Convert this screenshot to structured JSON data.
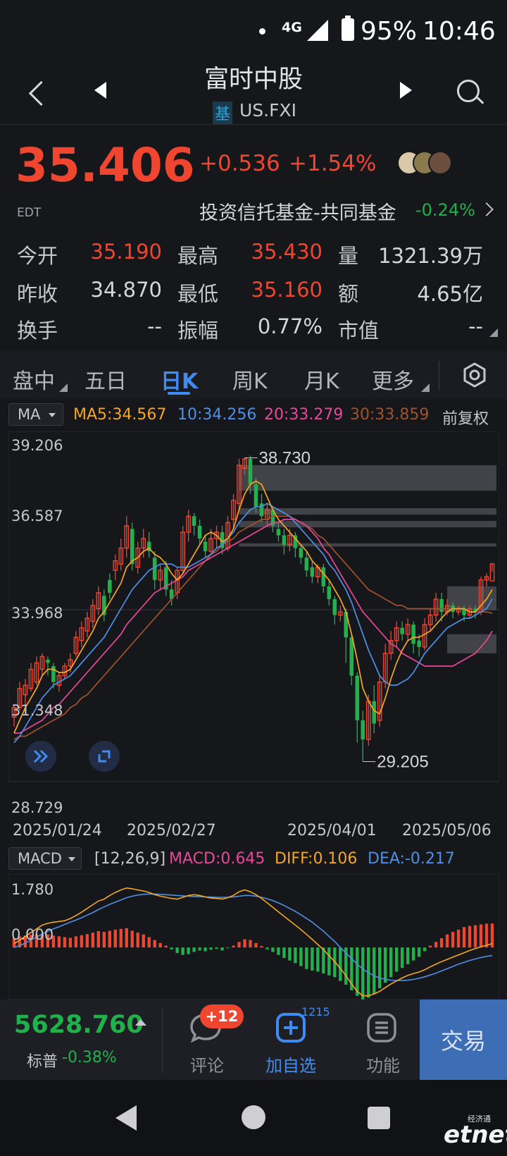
{
  "status_bar": {
    "network": "4G",
    "battery": "95%",
    "time": "10:46"
  },
  "header": {
    "title": "富时中股",
    "badge": "基",
    "ticker": "US.FXI"
  },
  "quote": {
    "price": "35.406",
    "timezone": "EDT",
    "change": "+0.536",
    "change_pct": "+1.54%",
    "category": "投资信托基金-共同基金",
    "category_change": "-0.24%"
  },
  "stats": [
    {
      "label": "今开",
      "value": "35.190",
      "color": "red"
    },
    {
      "label": "最高",
      "value": "35.430",
      "color": "red"
    },
    {
      "label": "量",
      "value": "1321.39万",
      "color": "plain"
    },
    {
      "label": "昨收",
      "value": "34.870",
      "color": "plain"
    },
    {
      "label": "最低",
      "value": "35.160",
      "color": "red"
    },
    {
      "label": "额",
      "value": "4.65亿",
      "color": "plain"
    },
    {
      "label": "换手",
      "value": "--",
      "color": "plain"
    },
    {
      "label": "振幅",
      "value": "0.77%",
      "color": "plain"
    },
    {
      "label": "市值",
      "value": "--",
      "color": "plain"
    }
  ],
  "tabs": [
    "盘中",
    "五日",
    "日K",
    "周K",
    "月K",
    "更多"
  ],
  "active_tab": "日K",
  "ma_legend": {
    "selector": "MA",
    "ma5": "MA5:34.567",
    "ma10": "10:34.256",
    "ma20": "20:33.279",
    "ma30": "30:33.859",
    "adjust": "前复权"
  },
  "colors": {
    "up": "#f0452e",
    "down": "#1fb24a",
    "ma5": "#f5a623",
    "ma10": "#4f8fe6",
    "ma20": "#e8479a",
    "ma30": "#a0522d",
    "accent": "#3e8cf1",
    "trade": "#3d6db4"
  },
  "chart_data": {
    "type": "candlestick",
    "y_axis_labels": [
      "39.206",
      "36.587",
      "33.968",
      "31.348",
      "28.729"
    ],
    "ylim": [
      28.729,
      39.206
    ],
    "x_axis_labels": [
      "2025/01/24",
      "2025/02/27",
      "2025/04/01",
      "2025/05/06"
    ],
    "high_annotation": "38.730",
    "low_annotation": "29.205",
    "candles": [
      [
        30.6,
        30.9,
        30.3,
        31.0
      ],
      [
        30.9,
        31.5,
        30.8,
        31.7
      ],
      [
        31.3,
        31.6,
        31.0,
        31.8
      ],
      [
        31.5,
        32.1,
        31.4,
        32.3
      ],
      [
        31.7,
        32.3,
        31.6,
        32.5
      ],
      [
        32.1,
        32.5,
        31.9,
        32.6
      ],
      [
        32.4,
        32.3,
        31.9,
        32.5
      ],
      [
        32.2,
        31.7,
        31.5,
        32.3
      ],
      [
        31.6,
        31.9,
        31.4,
        32.0
      ],
      [
        31.9,
        32.2,
        31.8,
        32.3
      ],
      [
        32.2,
        32.4,
        32.0,
        32.6
      ],
      [
        32.6,
        33.1,
        32.5,
        33.3
      ],
      [
        33.0,
        33.4,
        32.8,
        33.6
      ],
      [
        33.3,
        33.7,
        33.1,
        33.9
      ],
      [
        33.6,
        34.1,
        33.4,
        34.3
      ],
      [
        34.0,
        34.5,
        33.8,
        34.7
      ],
      [
        34.4,
        33.8,
        33.6,
        34.6
      ],
      [
        34.9,
        34.5,
        34.3,
        35.1
      ],
      [
        35.2,
        35.5,
        34.9,
        35.7
      ],
      [
        35.4,
        35.9,
        35.2,
        36.2
      ],
      [
        35.9,
        36.6,
        35.6,
        36.9
      ],
      [
        36.5,
        35.4,
        35.2,
        36.7
      ],
      [
        35.3,
        35.9,
        35.1,
        36.1
      ],
      [
        35.9,
        36.2,
        35.6,
        36.5
      ],
      [
        36.1,
        35.8,
        35.6,
        36.4
      ],
      [
        35.6,
        34.9,
        34.6,
        35.8
      ],
      [
        34.9,
        35.2,
        34.6,
        35.4
      ],
      [
        35.3,
        34.6,
        34.4,
        35.5
      ],
      [
        34.6,
        34.3,
        34.1,
        34.9
      ],
      [
        34.5,
        35.2,
        34.3,
        35.3
      ],
      [
        35.2,
        36.4,
        35.1,
        36.6
      ],
      [
        36.4,
        36.9,
        36.1,
        37.1
      ],
      [
        36.9,
        36.6,
        36.3,
        37.0
      ],
      [
        36.6,
        36.2,
        36.0,
        36.8
      ],
      [
        36.1,
        35.8,
        35.6,
        36.3
      ],
      [
        35.8,
        36.2,
        35.7,
        36.5
      ],
      [
        36.2,
        36.4,
        35.9,
        36.6
      ],
      [
        36.4,
        35.9,
        35.7,
        36.6
      ],
      [
        35.9,
        36.7,
        35.8,
        36.9
      ],
      [
        36.8,
        37.4,
        36.5,
        37.6
      ],
      [
        37.3,
        38.5,
        37.1,
        38.7
      ],
      [
        38.4,
        38.7,
        38.2,
        38.73
      ],
      [
        38.7,
        37.9,
        37.6,
        38.8
      ],
      [
        37.9,
        37.2,
        37.0,
        38.1
      ],
      [
        37.3,
        36.9,
        36.7,
        37.6
      ],
      [
        36.8,
        37.1,
        36.6,
        37.3
      ],
      [
        37.1,
        36.6,
        36.4,
        37.2
      ],
      [
        36.5,
        36.3,
        36.1,
        36.7
      ],
      [
        36.3,
        36.0,
        35.7,
        36.5
      ],
      [
        36.0,
        36.3,
        35.8,
        36.5
      ],
      [
        36.3,
        35.9,
        35.6,
        36.4
      ],
      [
        35.9,
        35.6,
        35.4,
        36.0
      ],
      [
        35.6,
        35.2,
        35.0,
        35.8
      ],
      [
        35.3,
        35.0,
        34.8,
        35.5
      ],
      [
        35.0,
        35.3,
        34.8,
        35.4
      ],
      [
        35.3,
        34.7,
        34.5,
        35.4
      ],
      [
        34.7,
        34.3,
        34.1,
        34.9
      ],
      [
        34.3,
        33.8,
        33.5,
        34.4
      ],
      [
        33.8,
        33.9,
        33.6,
        34.1
      ],
      [
        33.9,
        33.1,
        32.3,
        34.0
      ],
      [
        33.1,
        31.9,
        31.6,
        33.2
      ],
      [
        31.9,
        30.5,
        29.8,
        32.0
      ],
      [
        30.5,
        29.9,
        29.205,
        30.8
      ],
      [
        29.9,
        31.1,
        29.7,
        31.3
      ],
      [
        31.1,
        30.4,
        30.1,
        31.6
      ],
      [
        30.5,
        31.7,
        30.3,
        31.9
      ],
      [
        31.7,
        32.6,
        31.5,
        32.9
      ],
      [
        32.6,
        33.0,
        32.4,
        33.3
      ],
      [
        33.0,
        33.4,
        32.8,
        33.6
      ],
      [
        33.4,
        33.2,
        33.0,
        33.6
      ],
      [
        33.2,
        33.5,
        33.0,
        33.7
      ],
      [
        33.5,
        32.9,
        32.6,
        33.6
      ],
      [
        33.0,
        32.8,
        32.5,
        33.2
      ],
      [
        32.8,
        33.5,
        32.7,
        33.7
      ],
      [
        33.5,
        33.8,
        33.3,
        34.0
      ],
      [
        33.8,
        34.3,
        33.6,
        34.5
      ],
      [
        34.3,
        33.9,
        33.6,
        34.5
      ],
      [
        33.9,
        34.1,
        33.8,
        34.3
      ],
      [
        34.1,
        33.9,
        33.7,
        34.2
      ],
      [
        33.9,
        34.0,
        33.8,
        34.1
      ],
      [
        34.0,
        33.8,
        33.6,
        34.1
      ],
      [
        33.8,
        34.0,
        33.7,
        34.1
      ],
      [
        34.0,
        33.9,
        33.7,
        34.1
      ],
      [
        33.9,
        34.9,
        33.8,
        35.0
      ],
      [
        34.9,
        35.0,
        34.7,
        35.1
      ],
      [
        34.87,
        35.406,
        35.16,
        35.43
      ]
    ],
    "ma5": [
      30.1,
      30.5,
      30.9,
      31.2,
      31.5,
      31.9,
      32.1,
      32.1,
      32.0,
      32.0,
      32.1,
      32.4,
      32.7,
      33.0,
      33.3,
      33.7,
      33.9,
      34.2,
      34.5,
      34.8,
      35.3,
      35.5,
      35.6,
      35.8,
      35.9,
      35.7,
      35.6,
      35.4,
      35.1,
      34.9,
      35.1,
      35.4,
      35.7,
      36.0,
      36.3,
      36.4,
      36.3,
      36.1,
      36.2,
      36.5,
      37.1,
      37.6,
      37.9,
      38.0,
      37.9,
      37.5,
      37.1,
      36.8,
      36.6,
      36.4,
      36.2,
      36.0,
      35.8,
      35.5,
      35.3,
      35.1,
      34.9,
      34.6,
      34.3,
      33.9,
      33.2,
      32.4,
      31.5,
      31.1,
      30.8,
      30.7,
      31.2,
      31.8,
      32.3,
      32.7,
      33.0,
      33.1,
      33.1,
      33.2,
      33.3,
      33.5,
      33.7,
      33.9,
      34.0,
      34.0,
      34.0,
      33.9,
      33.9,
      34.1,
      34.3,
      34.6
    ],
    "ma10": [
      29.8,
      30.0,
      30.3,
      30.6,
      30.9,
      31.2,
      31.4,
      31.6,
      31.7,
      31.8,
      31.9,
      32.1,
      32.3,
      32.5,
      32.7,
      32.9,
      33.1,
      33.4,
      33.7,
      34.0,
      34.3,
      34.6,
      34.8,
      35.0,
      35.2,
      35.3,
      35.4,
      35.4,
      35.4,
      35.3,
      35.3,
      35.3,
      35.4,
      35.5,
      35.6,
      35.7,
      35.9,
      36.0,
      36.2,
      36.4,
      36.7,
      36.9,
      37.1,
      37.2,
      37.2,
      37.3,
      37.2,
      37.1,
      37.0,
      36.9,
      36.7,
      36.5,
      36.3,
      36.1,
      35.9,
      35.7,
      35.4,
      35.2,
      34.9,
      34.6,
      34.2,
      33.7,
      33.2,
      32.7,
      32.3,
      31.9,
      31.7,
      31.6,
      31.6,
      31.7,
      31.8,
      32.0,
      32.3,
      32.6,
      32.8,
      33.0,
      33.2,
      33.4,
      33.5,
      33.6,
      33.7,
      33.7,
      33.8,
      33.9,
      34.0,
      34.3
    ],
    "ma20": [
      30.1,
      30.1,
      30.2,
      30.3,
      30.4,
      30.5,
      30.7,
      30.9,
      31.0,
      31.2,
      31.4,
      31.6,
      31.8,
      32.0,
      32.2,
      32.4,
      32.6,
      32.8,
      33.0,
      33.2,
      33.5,
      33.7,
      33.9,
      34.1,
      34.3,
      34.5,
      34.6,
      34.7,
      34.8,
      34.9,
      35.0,
      35.2,
      35.3,
      35.4,
      35.5,
      35.6,
      35.7,
      35.8,
      35.9,
      36.0,
      36.1,
      36.2,
      36.3,
      36.4,
      36.5,
      36.6,
      36.7,
      36.7,
      36.8,
      36.8,
      36.8,
      36.7,
      36.6,
      36.4,
      36.2,
      35.9,
      35.7,
      35.4,
      35.1,
      34.8,
      34.5,
      34.2,
      33.9,
      33.7,
      33.5,
      33.3,
      33.1,
      32.9,
      32.8,
      32.6,
      32.5,
      32.4,
      32.3,
      32.2,
      32.2,
      32.2,
      32.2,
      32.2,
      32.2,
      32.3,
      32.4,
      32.5,
      32.6,
      32.8,
      33.0,
      33.3
    ],
    "ma30": [
      29.9,
      30.0,
      30.0,
      30.1,
      30.2,
      30.3,
      30.4,
      30.5,
      30.6,
      30.7,
      30.9,
      31.0,
      31.2,
      31.3,
      31.5,
      31.7,
      31.9,
      32.1,
      32.3,
      32.5,
      32.7,
      32.9,
      33.1,
      33.3,
      33.5,
      33.7,
      33.9,
      34.1,
      34.3,
      34.5,
      34.7,
      34.9,
      35.1,
      35.3,
      35.5,
      35.7,
      35.8,
      36.0,
      36.1,
      36.2,
      36.4,
      36.5,
      36.6,
      36.7,
      36.8,
      36.8,
      36.9,
      36.9,
      36.9,
      36.9,
      36.8,
      36.7,
      36.6,
      36.5,
      36.3,
      36.2,
      36.0,
      35.8,
      35.6,
      35.4,
      35.2,
      35.0,
      34.8,
      34.6,
      34.5,
      34.4,
      34.3,
      34.2,
      34.1,
      34.1,
      34.0,
      34.0,
      34.0,
      34.0,
      34.0,
      34.0,
      34.0,
      34.0,
      34.0,
      34.0,
      34.0,
      33.9,
      33.9,
      33.9,
      33.9,
      33.86
    ]
  },
  "macd": {
    "selector": "MACD",
    "params": "[12,26,9]",
    "macd": "MACD:0.645",
    "diff": "DIFF:0.106",
    "dea": "DEA:-0.217",
    "y_axis_labels": [
      "1.780",
      "0.000"
    ]
  },
  "macd_data": {
    "ylim": [
      -1.4,
      1.9
    ],
    "hist": [
      0.25,
      0.3,
      0.32,
      0.34,
      0.35,
      0.36,
      0.35,
      0.32,
      0.3,
      0.28,
      0.26,
      0.3,
      0.33,
      0.36,
      0.4,
      0.44,
      0.42,
      0.45,
      0.48,
      0.5,
      0.52,
      0.45,
      0.4,
      0.35,
      0.28,
      0.2,
      0.12,
      0.05,
      -0.05,
      -0.15,
      -0.2,
      -0.18,
      -0.12,
      -0.08,
      -0.1,
      -0.06,
      -0.04,
      -0.08,
      -0.02,
      0.05,
      0.15,
      0.22,
      0.2,
      0.12,
      0.04,
      -0.05,
      -0.12,
      -0.2,
      -0.28,
      -0.35,
      -0.42,
      -0.5,
      -0.58,
      -0.62,
      -0.65,
      -0.7,
      -0.75,
      -0.8,
      -0.9,
      -1.0,
      -1.15,
      -1.3,
      -1.4,
      -1.35,
      -1.25,
      -1.1,
      -0.95,
      -0.8,
      -0.65,
      -0.55,
      -0.45,
      -0.35,
      -0.25,
      -0.1,
      0.05,
      0.15,
      0.25,
      0.35,
      0.42,
      0.48,
      0.55,
      0.58,
      0.6,
      0.62,
      0.64,
      0.645
    ],
    "diff": [
      0.1,
      0.2,
      0.3,
      0.4,
      0.5,
      0.6,
      0.65,
      0.68,
      0.7,
      0.72,
      0.78,
      0.86,
      0.95,
      1.05,
      1.15,
      1.25,
      1.3,
      1.4,
      1.48,
      1.55,
      1.6,
      1.58,
      1.55,
      1.52,
      1.48,
      1.42,
      1.38,
      1.35,
      1.32,
      1.3,
      1.35,
      1.4,
      1.42,
      1.4,
      1.36,
      1.33,
      1.32,
      1.3,
      1.34,
      1.4,
      1.5,
      1.55,
      1.5,
      1.42,
      1.32,
      1.2,
      1.08,
      0.96,
      0.84,
      0.72,
      0.6,
      0.48,
      0.35,
      0.22,
      0.08,
      -0.06,
      -0.22,
      -0.38,
      -0.56,
      -0.76,
      -0.98,
      -1.18,
      -1.3,
      -1.3,
      -1.25,
      -1.18,
      -1.08,
      -0.98,
      -0.9,
      -0.82,
      -0.75,
      -0.7,
      -0.66,
      -0.6,
      -0.52,
      -0.45,
      -0.38,
      -0.32,
      -0.26,
      -0.2,
      -0.14,
      -0.08,
      -0.03,
      0.02,
      0.06,
      0.106
    ],
    "dea": [
      0.0,
      0.05,
      0.12,
      0.2,
      0.28,
      0.36,
      0.44,
      0.5,
      0.56,
      0.62,
      0.68,
      0.74,
      0.8,
      0.87,
      0.94,
      1.02,
      1.09,
      1.16,
      1.22,
      1.28,
      1.34,
      1.38,
      1.41,
      1.43,
      1.44,
      1.44,
      1.43,
      1.42,
      1.41,
      1.4,
      1.39,
      1.38,
      1.37,
      1.37,
      1.36,
      1.36,
      1.35,
      1.35,
      1.35,
      1.36,
      1.38,
      1.4,
      1.4,
      1.38,
      1.35,
      1.31,
      1.26,
      1.2,
      1.13,
      1.05,
      0.97,
      0.88,
      0.78,
      0.68,
      0.56,
      0.44,
      0.3,
      0.16,
      0.0,
      -0.15,
      -0.3,
      -0.45,
      -0.58,
      -0.68,
      -0.76,
      -0.82,
      -0.86,
      -0.88,
      -0.89,
      -0.89,
      -0.88,
      -0.86,
      -0.83,
      -0.79,
      -0.74,
      -0.69,
      -0.63,
      -0.57,
      -0.51,
      -0.45,
      -0.4,
      -0.35,
      -0.31,
      -0.27,
      -0.24,
      -0.217
    ]
  },
  "bottom": {
    "index_value": "5628.760",
    "index_name": "标普",
    "index_change": "-0.38%",
    "comments_label": "评论",
    "comments_badge": "+12",
    "watch_label": "加自选",
    "watch_count": "1215",
    "more_label": "功能",
    "trade_label": "交易"
  },
  "watermark": {
    "brand": "etnet",
    "caption": "经济通"
  }
}
